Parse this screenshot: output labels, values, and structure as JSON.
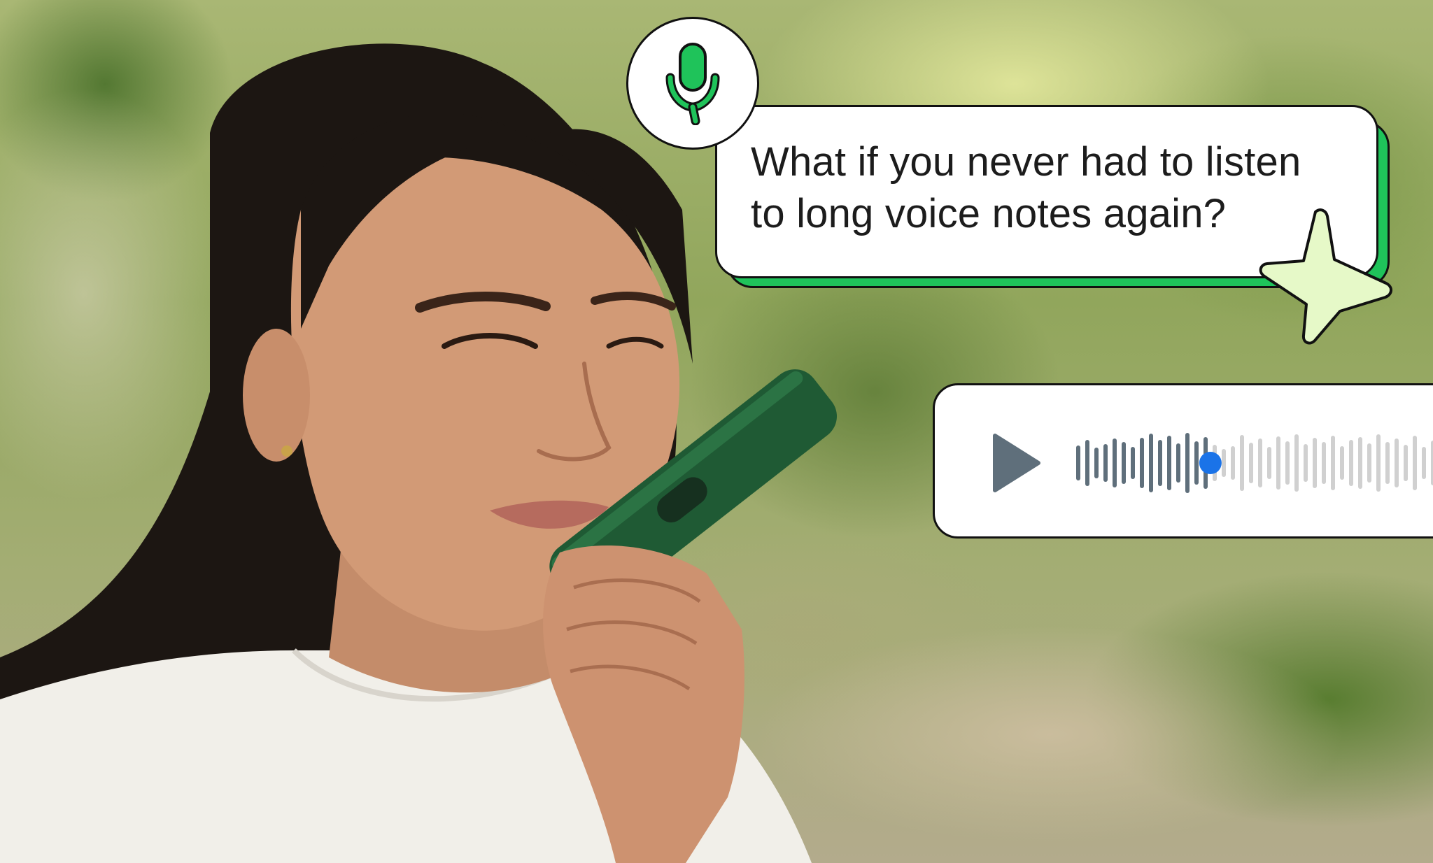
{
  "bubble": {
    "line1": "What if you never had to listen",
    "line2": "to long voice notes again?"
  },
  "colors": {
    "accent_green": "#1fc35a",
    "sparkle_fill": "#e6f9c8",
    "played_bar": "#5f6f7b",
    "unplayed_bar": "#d0d0d0",
    "scrubber": "#1a73e8",
    "phone_case": "#1f5a34"
  },
  "icons": {
    "mic": "microphone-icon",
    "sparkle": "sparkle-star-icon",
    "play": "play-icon"
  },
  "player": {
    "progress": 0.36
  }
}
